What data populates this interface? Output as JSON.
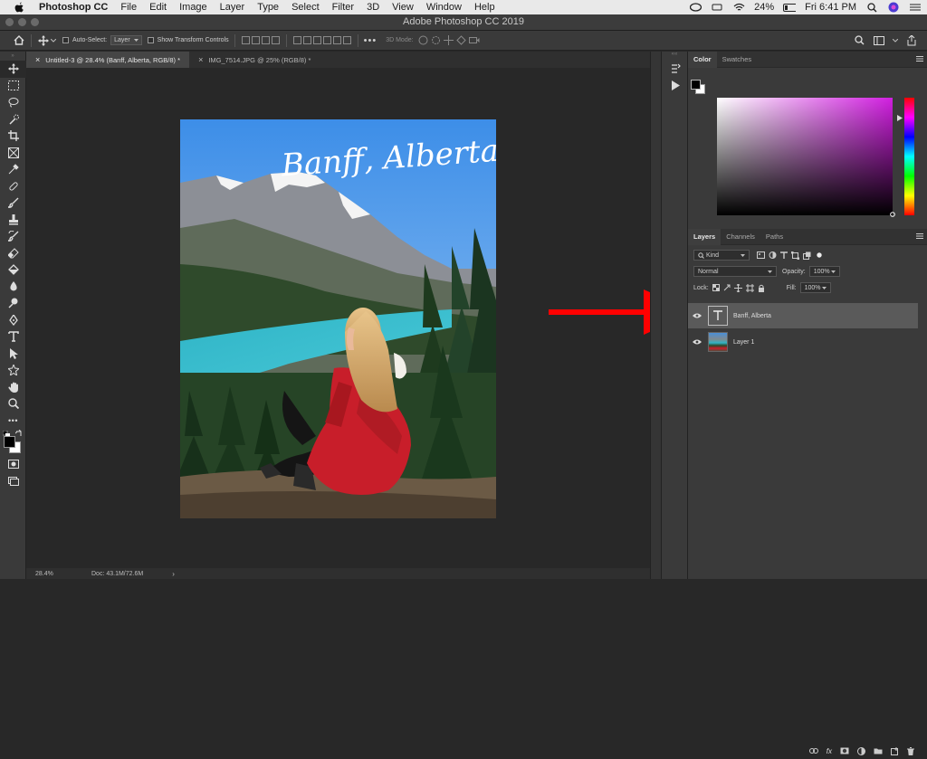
{
  "menubar": {
    "app_name": "Photoshop CC",
    "items": [
      "File",
      "Edit",
      "Image",
      "Layer",
      "Type",
      "Select",
      "Filter",
      "3D",
      "View",
      "Window",
      "Help"
    ],
    "battery": "24%",
    "clock": "Fri 6:41 PM"
  },
  "window": {
    "title": "Adobe Photoshop CC 2019"
  },
  "options_bar": {
    "auto_select_label": "Auto-Select:",
    "auto_select_value": "Layer",
    "show_transform_label": "Show Transform Controls",
    "mode_label": "3D Mode:"
  },
  "doc_tabs": [
    {
      "label": "Untitled-3 @ 28.4% (Banff, Alberta, RGB/8) *",
      "active": true
    },
    {
      "label": "IMG_7514.JPG @ 25% (RGB/8) *",
      "active": false
    }
  ],
  "canvas": {
    "overlay_text": "Banff, Alberta"
  },
  "status": {
    "zoom": "28.4%",
    "doc_size": "Doc: 43.1M/72.6M"
  },
  "color_panel": {
    "tabs": [
      "Color",
      "Swatches"
    ]
  },
  "layers_panel": {
    "tabs": [
      "Layers",
      "Channels",
      "Paths"
    ],
    "filter_kind": "Kind",
    "blend_mode": "Normal",
    "opacity_label": "Opacity:",
    "opacity_value": "100%",
    "lock_label": "Lock:",
    "fill_label": "Fill:",
    "fill_value": "100%",
    "layers": [
      {
        "name": "Banff, Alberta",
        "type": "text",
        "selected": true
      },
      {
        "name": "Layer 1",
        "type": "image",
        "selected": false
      }
    ]
  },
  "accent_colors": {
    "annotation_arrow": "#ff0000",
    "selected_layer": "#5a5a5a"
  }
}
